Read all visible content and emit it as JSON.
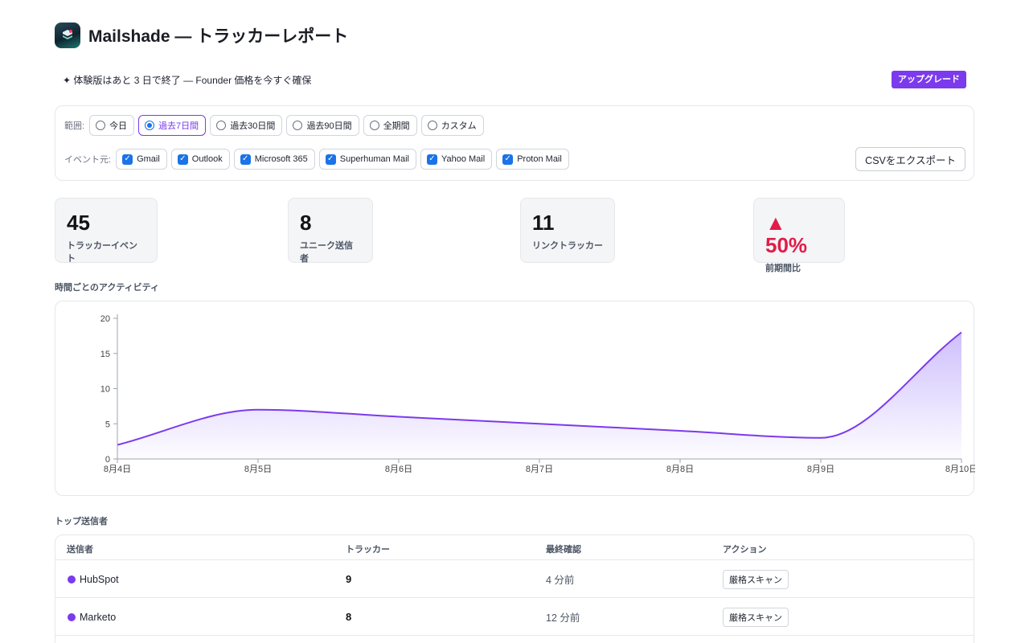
{
  "app": {
    "title": "Mailshade — トラッカーレポート"
  },
  "trial": {
    "text": "✦ 体験版はあと 3 日で終了 — Founder 価格を今すぐ確保",
    "upgrade_label": "アップグレード"
  },
  "filters": {
    "range_label": "範囲:",
    "ranges": [
      {
        "label": "今日",
        "selected": false
      },
      {
        "label": "過去7日間",
        "selected": true
      },
      {
        "label": "過去30日間",
        "selected": false
      },
      {
        "label": "過去90日間",
        "selected": false
      },
      {
        "label": "全期間",
        "selected": false
      },
      {
        "label": "カスタム",
        "selected": false
      }
    ],
    "source_label": "イベント元:",
    "sources": [
      {
        "label": "Gmail",
        "checked": true
      },
      {
        "label": "Outlook",
        "checked": true
      },
      {
        "label": "Microsoft 365",
        "checked": true
      },
      {
        "label": "Superhuman Mail",
        "checked": true
      },
      {
        "label": "Yahoo Mail",
        "checked": true
      },
      {
        "label": "Proton Mail",
        "checked": true
      }
    ],
    "export_label": "CSVをエクスポート"
  },
  "stats": [
    {
      "value": "45",
      "label": "トラッカーイベント"
    },
    {
      "value": "8",
      "label": "ユニーク送信者"
    },
    {
      "value": "11",
      "label": "リンクトラッカー"
    },
    {
      "value": "▲ 50%",
      "label": "前期間比"
    }
  ],
  "activity": {
    "title": "時間ごとのアクティビティ"
  },
  "chart_data": {
    "type": "area",
    "title": "",
    "xlabel": "",
    "ylabel": "",
    "x": [
      "8月4日",
      "8月5日",
      "8月6日",
      "8月7日",
      "8月8日",
      "8月9日",
      "8月10日"
    ],
    "series": [
      {
        "values": [
          2,
          7,
          6,
          5,
          4,
          3,
          18
        ]
      }
    ],
    "ylim": [
      0,
      20
    ],
    "yticks": [
      0,
      5,
      10,
      15,
      20
    ],
    "grid": false,
    "line_color": "#7c3aed",
    "fill_color": "#a78bfa"
  },
  "top_senders": {
    "title": "トップ送信者",
    "columns": [
      "送信者",
      "トラッカー",
      "最終確認",
      "アクション"
    ],
    "rows": [
      {
        "sender": "HubSpot",
        "trackers": "9",
        "last_seen": "4 分前",
        "action": "厳格スキャン",
        "color": "#7c3aed"
      },
      {
        "sender": "Marketo",
        "trackers": "8",
        "last_seen": "12 分前",
        "action": "厳格スキャン",
        "color": "#7c3aed"
      }
    ]
  }
}
